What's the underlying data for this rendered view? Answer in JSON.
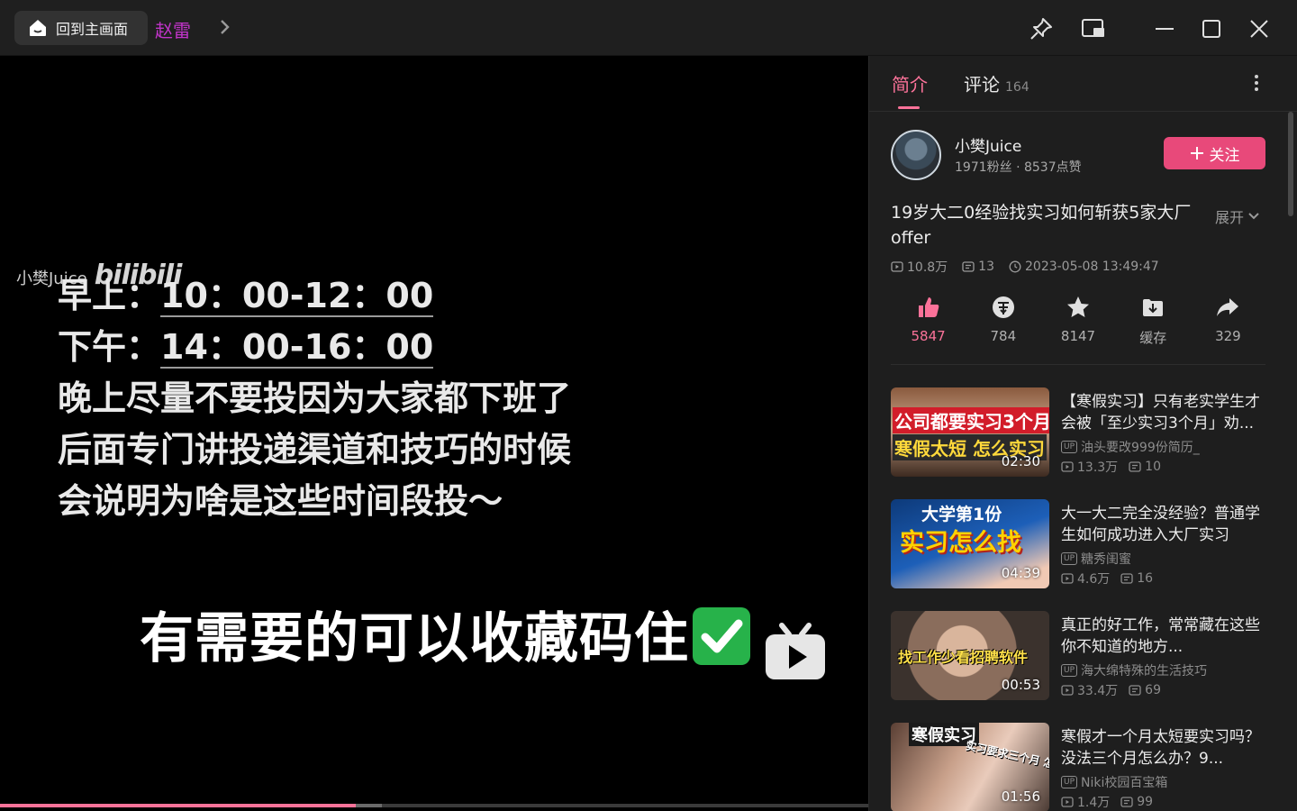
{
  "titlebar": {
    "home_label": "回到主画面",
    "title": "赵雷",
    "icons": [
      "pin-icon",
      "miniplayer-icon",
      "minimize-icon",
      "maximize-icon",
      "close-icon"
    ]
  },
  "player": {
    "watermark_name": "小樊Juice",
    "watermark_logo": "bilibili",
    "lines": [
      {
        "label": "早上：",
        "value": "10：00-12：00"
      },
      {
        "label": "下午：",
        "value": "14：00-16：00"
      }
    ],
    "plain_lines": [
      "晚上尽量不要投因为大家都下班了",
      "后面专门讲投递渠道和技巧的时候",
      "会说明为啥是这些时间段投～"
    ],
    "caption": "有需要的可以收藏码住",
    "progress": 0.41,
    "buffered": 0.44
  },
  "tabs": [
    {
      "label": "简介",
      "active": true
    },
    {
      "label": "评论",
      "count": "164"
    }
  ],
  "uploader": {
    "name": "小樊Juice",
    "stats": "1971粉丝 · 8537点赞",
    "follow_label": "关注"
  },
  "video": {
    "title": "19岁大二0经验找实习如何斩获5家大厂offer",
    "expand_label": "展开",
    "views": "10.8万",
    "danmaku": "13",
    "date": "2023-05-08 13:49:47"
  },
  "actions": [
    {
      "name": "like",
      "value": "5847"
    },
    {
      "name": "coin",
      "value": "784"
    },
    {
      "name": "favorite",
      "value": "8147"
    },
    {
      "name": "cache",
      "value": "缓存"
    },
    {
      "name": "share",
      "value": "329"
    }
  ],
  "recommendations": [
    {
      "title": "【寒假实习】只有老实学生才会被「至少实习3个月」劝...",
      "up": "油头要改999份简历_",
      "views": "13.3万",
      "danmaku": "10",
      "duration": "02:30",
      "thumb_lines": [
        "公司都要实习3个月",
        "寒假太短 怎么实习"
      ]
    },
    {
      "title": "大一大二完全没经验？普通学生如何成功进入大厂实习",
      "up": "糖秀闺蜜",
      "views": "4.6万",
      "danmaku": "16",
      "duration": "04:39",
      "thumb_lines": [
        "大学第1份",
        "实习怎么找"
      ]
    },
    {
      "title": "真正的好工作，常常藏在这些你不知道的地方...",
      "up": "海大绵特殊的生活技巧",
      "views": "33.4万",
      "danmaku": "69",
      "duration": "00:53",
      "thumb_lines": [
        "找工作少看招聘软件"
      ]
    },
    {
      "title": "寒假才一个月太短要实习吗？没法三个月怎么办？9...",
      "up": "Niki校园百宝箱",
      "views": "1.4万",
      "danmaku": "99",
      "duration": "01:56",
      "thumb_lines": [
        "寒假实习",
        "实习要求三个月 怎么办?"
      ]
    }
  ],
  "colors": {
    "accent": "#fb7299",
    "follow_bg": "#e8497a",
    "panel_bg": "#1e1e1e",
    "titlebar_bg": "#1f1f1f"
  }
}
